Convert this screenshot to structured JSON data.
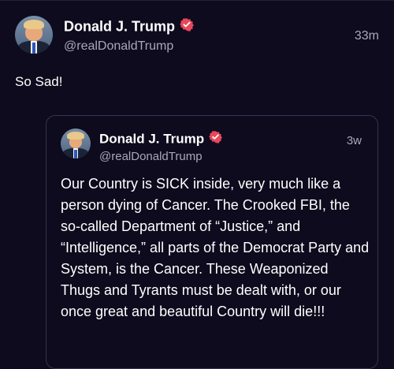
{
  "post": {
    "author_name": "Donald J. Trump",
    "author_handle": "@realDonaldTrump",
    "time": "33m",
    "text": "So Sad!"
  },
  "quoted_post": {
    "author_name": "Donald J. Trump",
    "author_handle": "@realDonaldTrump",
    "time": "3w",
    "text": "Our Country is SICK inside, very much like a person dying of Cancer. The Crooked FBI, the so-called Department of “Justice,” and “Intelligence,” all parts of the Democrat Party and System, is the Cancer. These Weaponized Thugs and Tyrants must be dealt with, or our once great and beautiful Country will die!!!"
  },
  "colors": {
    "background": "#0d0b1d",
    "verified_badge": "#e8475a",
    "secondary_text": "#a9a7b8",
    "card_border": "#353352"
  },
  "icons": {
    "verified": "verified-badge-icon"
  }
}
